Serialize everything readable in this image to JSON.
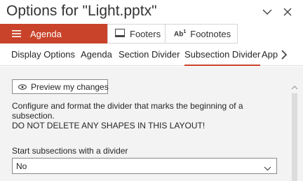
{
  "window": {
    "title": "Options for \"Light.pptx\""
  },
  "toolbar": {
    "agenda_label": "Agenda",
    "footers_label": "Footers",
    "footnotes_icon_text": "Ab",
    "footnotes_label": "Footnotes"
  },
  "tabs": [
    {
      "label": "Display Options"
    },
    {
      "label": "Agenda"
    },
    {
      "label": "Section Divider"
    },
    {
      "label": "Subsection Divider"
    },
    {
      "label": "App"
    }
  ],
  "active_tab": "Subsection Divider",
  "panel": {
    "preview_label": "Preview my changes",
    "description_line1": "Configure and format the divider that marks the beginning of a subsection.",
    "description_line2": "DO NOT DELETE ANY SHAPES IN THIS LAYOUT!",
    "field_label": "Start subsections with a divider",
    "select_value": "No"
  },
  "colors": {
    "accent": "#c9432a",
    "panel_bg": "#f3f3f3"
  },
  "icons": {
    "collapse": "chevron-down-icon",
    "close": "close-icon",
    "agenda": "hamburger-icon",
    "footers": "footer-icon",
    "tabs_more": "chevron-right-icon",
    "preview": "eye-icon",
    "select": "chevron-down-icon",
    "scroll": "scroll-up-icon"
  }
}
